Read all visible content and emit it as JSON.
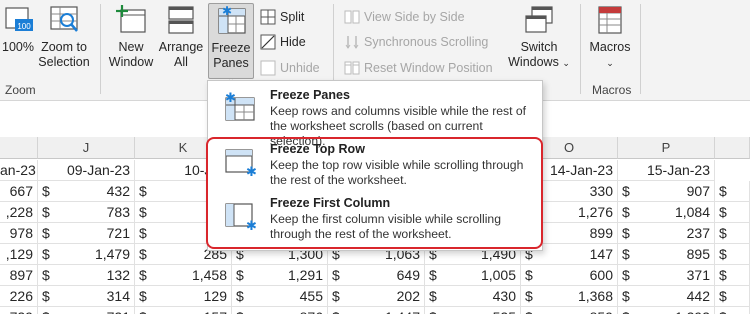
{
  "ribbon": {
    "zoom100_label": "100%",
    "zoom_to_selection_label": [
      "Zoom to",
      "Selection"
    ],
    "zoom_group_label": "Zoom",
    "new_window_label": [
      "New",
      "Window"
    ],
    "arrange_all_label": [
      "Arrange",
      "All"
    ],
    "freeze_panes_label": [
      "Freeze",
      "Panes"
    ],
    "split_label": "Split",
    "hide_label": "Hide",
    "unhide_label": "Unhide",
    "view_side_by_side_label": "View Side by Side",
    "synchronous_scrolling_label": "Synchronous Scrolling",
    "reset_window_position_label": "Reset Window Position",
    "switch_windows_label": [
      "Switch",
      "Windows"
    ],
    "macros_label": "Macros",
    "macros_group_label": "Macros",
    "dropdown_caret": "⌄"
  },
  "dropdown": {
    "items": [
      {
        "title": "Freeze Panes",
        "description": "Keep rows and columns visible while the rest of the worksheet scrolls (based on current selection).",
        "icon": "freeze-panes-icon"
      },
      {
        "title": "Freeze Top Row",
        "description": "Keep the top row visible while scrolling through the rest of the worksheet.",
        "icon": "freeze-top-row-icon"
      },
      {
        "title": "Freeze First Column",
        "description": "Keep the first column visible while scrolling through the rest of the worksheet.",
        "icon": "freeze-first-column-icon"
      }
    ]
  },
  "sheet": {
    "columns": [
      "J",
      "K",
      "O",
      "P"
    ],
    "dates": [
      "an-23",
      "09-Jan-23",
      "10-Jan",
      "14-Jan-23",
      "15-Jan-23"
    ],
    "currency": "$",
    "rows": [
      {
        "i": "667",
        "j": "432",
        "k": "1,3",
        "o": "330",
        "p": "907"
      },
      {
        "i": ",228",
        "j": "783",
        "k": "2",
        "o": "1,276",
        "p": "1,084"
      },
      {
        "i": "978",
        "j": "721",
        "k": "8",
        "o": "899",
        "p": "237"
      },
      {
        "i": ",129",
        "j": "1,479",
        "k": "285",
        "l": "1,300",
        "m": "1,063",
        "n": "1,490",
        "o": "147",
        "p": "895"
      },
      {
        "i": "897",
        "j": "132",
        "k": "1,458",
        "l": "1,291",
        "m": "649",
        "n": "1,005",
        "o": "600",
        "p": "371"
      },
      {
        "i": "226",
        "j": "314",
        "k": "129",
        "l": "455",
        "m": "202",
        "n": "430",
        "o": "1,368",
        "p": "442"
      },
      {
        "i": "729",
        "j": "721",
        "k": "157",
        "l": "876",
        "m": "1,447",
        "n": "525",
        "o": "859",
        "p": "1,293"
      }
    ]
  },
  "colors": {
    "highlight": "#d9262c",
    "accent_blue": "#1b7ed6"
  }
}
